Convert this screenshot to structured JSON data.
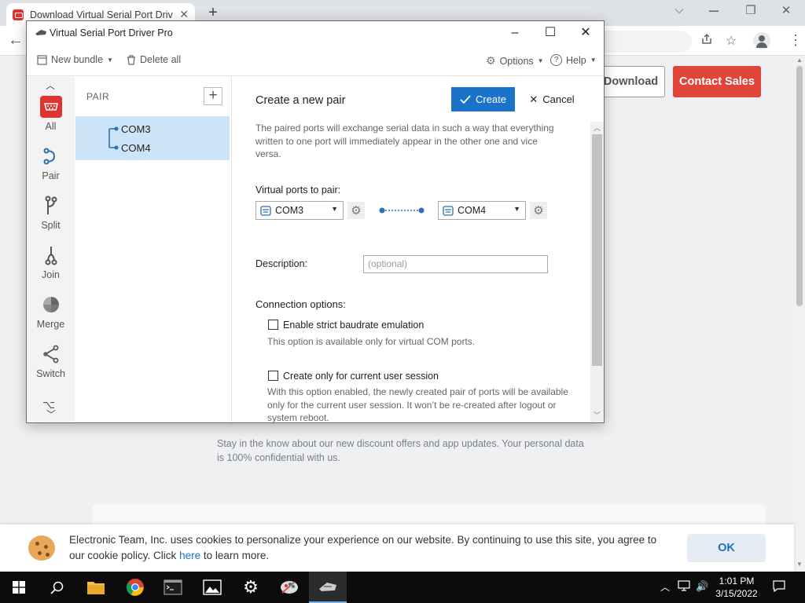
{
  "browser": {
    "tab_title": "Download Virtual Serial Port Driv",
    "tab_close": "✕",
    "new_tab": "+",
    "min": "⌵",
    "restore": "❐",
    "close": "✕"
  },
  "webpage": {
    "download_label": "Download",
    "contact_label": "Contact Sales",
    "newsletter_text": "Stay in the know about our new discount offers and app updates. Your personal data is 100% confidential with us."
  },
  "cookie": {
    "text_before": "Electronic Team, Inc. uses cookies to personalize your experience on our website. By continuing to use this site, you agree to our cookie policy. Click ",
    "link": "here",
    "text_after": " to learn more.",
    "ok_label": "OK"
  },
  "app": {
    "title": "Virtual Serial Port Driver Pro",
    "menu": {
      "new_bundle": "New bundle",
      "delete_all": "Delete all",
      "options": "Options",
      "help": "Help"
    },
    "sidebar": {
      "items": [
        {
          "label": "All",
          "icon": "serial-port-icon"
        },
        {
          "label": "Pair",
          "icon": "pair-icon"
        },
        {
          "label": "Split",
          "icon": "split-icon"
        },
        {
          "label": "Join",
          "icon": "join-icon"
        },
        {
          "label": "Merge",
          "icon": "merge-icon"
        },
        {
          "label": "Switch",
          "icon": "switch-icon"
        }
      ]
    },
    "pairs": {
      "header": "PAIR",
      "add": "+",
      "items": [
        {
          "port_a": "COM3",
          "port_b": "COM4"
        }
      ]
    },
    "form": {
      "title": "Create a new pair",
      "create_label": "Create",
      "cancel_label": "Cancel",
      "description": "The paired ports will exchange serial data in such a way that everything written to one port will immediately appear in the other one and vice versa.",
      "ports_label": "Virtual ports to pair:",
      "port_a": "COM3",
      "port_b": "COM4",
      "description_label": "Description:",
      "description_placeholder": "(optional)",
      "connection_label": "Connection options:",
      "option1_label": "Enable strict baudrate emulation",
      "option1_hint": "This option is available only for virtual COM ports.",
      "option1_checked": false,
      "option2_label": "Create only for current user session",
      "option2_hint": "With this option enabled, the newly created pair of ports will be available only for the current user session. It won’t be re-created after logout or system reboot.",
      "option2_checked": false
    }
  },
  "taskbar": {
    "time": "1:01 PM",
    "date": "3/15/2022"
  },
  "colors": {
    "accent": "#1a73c8",
    "contact_sales": "#e0453b",
    "pair_selected": "#cce4f7",
    "all_icon": "#e0322f"
  }
}
